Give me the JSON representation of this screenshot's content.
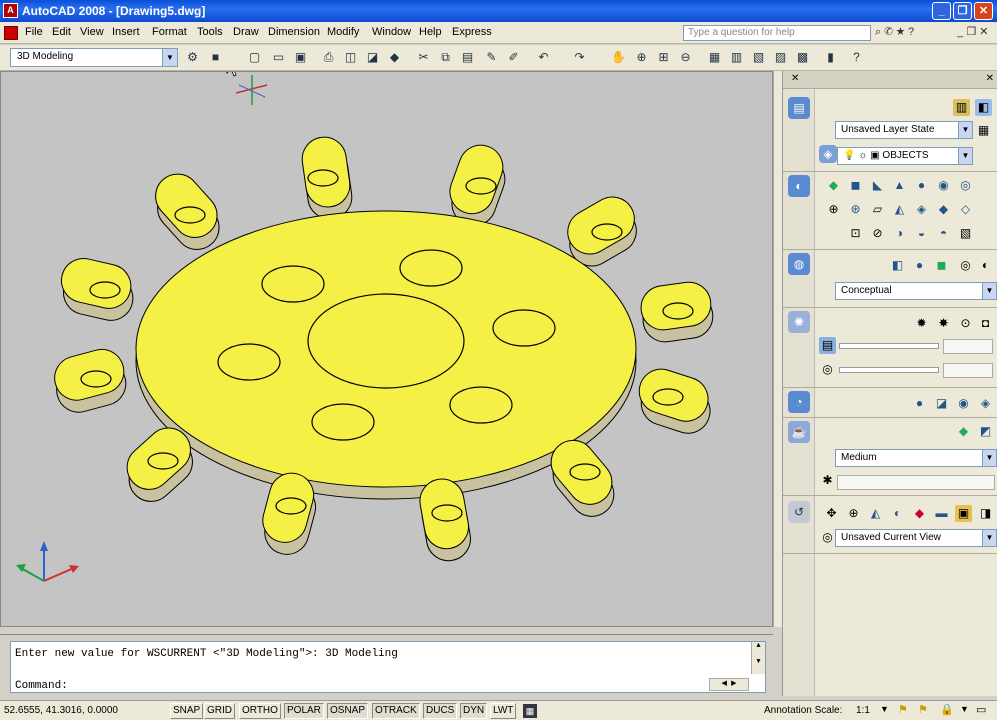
{
  "window": {
    "title": "AutoCAD 2008 - [Drawing5.dwg]",
    "app_icon_letter": "A",
    "controls": [
      "_",
      "❐",
      "✕"
    ]
  },
  "menus": [
    "File",
    "Edit",
    "View",
    "Insert",
    "Format",
    "Tools",
    "Draw",
    "Dimension",
    "Modify",
    "Window",
    "Help",
    "Express"
  ],
  "help_search": {
    "placeholder": "Type a question for help"
  },
  "toolbar": {
    "workspace": "3D Modeling",
    "icons": [
      "workspace-settings-icon",
      "workspace-save-icon",
      "qnew-icon",
      "open-icon",
      "save-icon",
      "plot-icon",
      "plot-preview-icon",
      "publish-icon",
      "3d-dwf-icon",
      "cut-icon",
      "copy-icon",
      "paste-icon",
      "match-properties-icon",
      "block-editor-icon",
      "undo-icon",
      "redo-icon",
      "pan-icon",
      "zoom-realtime-icon",
      "zoom-window-icon",
      "zoom-previous-icon",
      "properties-icon",
      "design-center-icon",
      "tool-palettes-icon",
      "sheet-set-icon",
      "markup-icon",
      "quickcalc-icon",
      "help-icon"
    ]
  },
  "dashboard": {
    "layers": {
      "state": "Unsaved Layer State",
      "current_layer": "OBJECTS"
    },
    "visual_style": "Conceptual",
    "material_quality": "Medium",
    "view": "Unsaved Current View"
  },
  "command_line": {
    "history": "Enter new value for WSCURRENT <\"3D Modeling\">: 3D Modeling",
    "prompt": "Command:"
  },
  "status": {
    "coordinates": "52.6555, 41.3016, 0.0000",
    "toggles": [
      {
        "label": "SNAP",
        "on": false
      },
      {
        "label": "GRID",
        "on": false
      },
      {
        "label": "ORTHO",
        "on": false
      },
      {
        "label": "POLAR",
        "on": true
      },
      {
        "label": "OSNAP",
        "on": true
      },
      {
        "label": "OTRACK",
        "on": true
      },
      {
        "label": "DUCS",
        "on": true
      },
      {
        "label": "DYN",
        "on": true
      },
      {
        "label": "LWT",
        "on": false
      }
    ],
    "annotation_scale_label": "Annotation Scale:",
    "annotation_scale_value": "1:1"
  },
  "colors": {
    "titlebar": "#0a4fd8",
    "part_fill": "#f4f046",
    "part_side": "#c8c2a0",
    "viewport_bg": "#c4c4c4"
  }
}
